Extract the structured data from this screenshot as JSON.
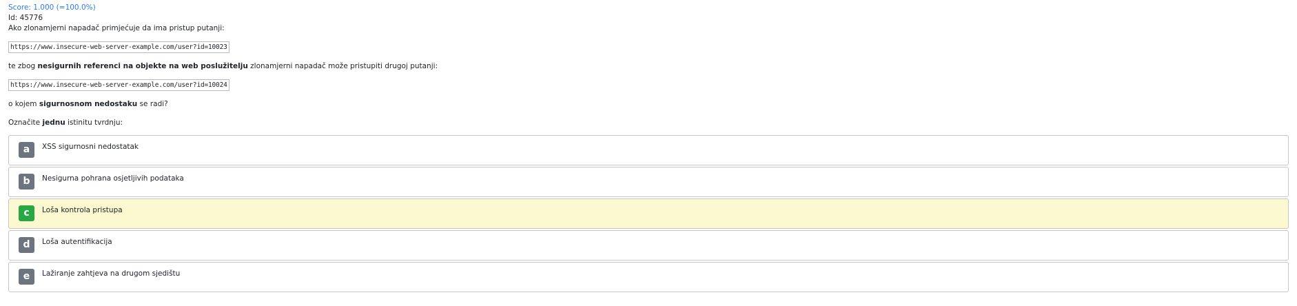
{
  "score_text": "Score: 1.000 (=100.0%)",
  "id_text": "Id: 45776",
  "question": {
    "intro": "Ako zlonamjerni napadač primjećuje da ima pristup putanji:",
    "url1": "https://www.insecure-web-server-example.com/user?id=10023",
    "middle_pre": "te zbog ",
    "middle_bold": "nesigurnih referenci na objekte na web poslužitelju",
    "middle_post": " zlonamjerni napadač može pristupiti drugoj putanji:",
    "url2": "https://www.insecure-web-server-example.com/user?id=10024",
    "final_pre": "o kojem ",
    "final_bold": "sigurnosnom nedostaku",
    "final_post": " se radi?"
  },
  "instruction": {
    "pre": "Označite ",
    "bold": "jednu",
    "post": " istinitu tvrdnju:"
  },
  "answers": [
    {
      "letter": "a",
      "text": "XSS sigurnosni nedostatak",
      "correct": false
    },
    {
      "letter": "b",
      "text": "Nesigurna pohrana osjetljivih podataka",
      "correct": false
    },
    {
      "letter": "c",
      "text": "Loša kontrola pristupa",
      "correct": true
    },
    {
      "letter": "d",
      "text": "Loša autentifikacija",
      "correct": false
    },
    {
      "letter": "e",
      "text": "Lažiranje zahtjeva na drugom sjedištu",
      "correct": false
    }
  ],
  "colors": {
    "score": "#2f7be0",
    "badge_default": "#6c7480",
    "badge_correct": "#28a745",
    "correct_bg": "#fcf8cf"
  }
}
